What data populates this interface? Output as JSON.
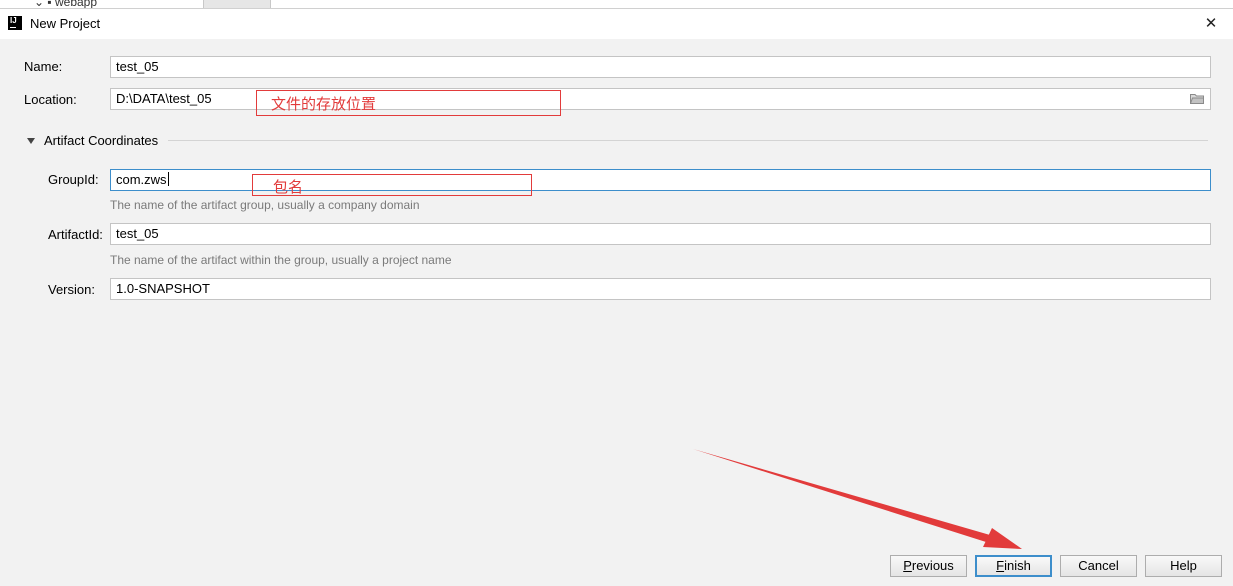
{
  "background": {
    "tree_item": "webapp"
  },
  "window": {
    "title": "New Project",
    "app_icon_text": "IJ",
    "close_glyph": "✕"
  },
  "form": {
    "name_label": "Name:",
    "name_value": "test_05",
    "location_label": "Location:",
    "location_value": "D:\\DATA\\test_05"
  },
  "artifact": {
    "section_title": "Artifact Coordinates",
    "group_id_label": "GroupId:",
    "group_id_value": "com.zws",
    "group_id_hint": "The name of the artifact group, usually a company domain",
    "artifact_id_label": "ArtifactId:",
    "artifact_id_value": "test_05",
    "artifact_id_hint": "The name of the artifact within the group, usually a project name",
    "version_label": "Version:",
    "version_value": "1.0-SNAPSHOT"
  },
  "annotations": {
    "location_note": "文件的存放位置",
    "group_note": "包名",
    "color": "#e23b3b"
  },
  "buttons": {
    "previous_first": "P",
    "previous_rest": "revious",
    "finish_first": "F",
    "finish_rest": "inish",
    "cancel": "Cancel",
    "help": "Help"
  },
  "colors": {
    "focus": "#3d8ecb",
    "hint": "#7a7a7a",
    "annotation": "#e23b3b"
  }
}
